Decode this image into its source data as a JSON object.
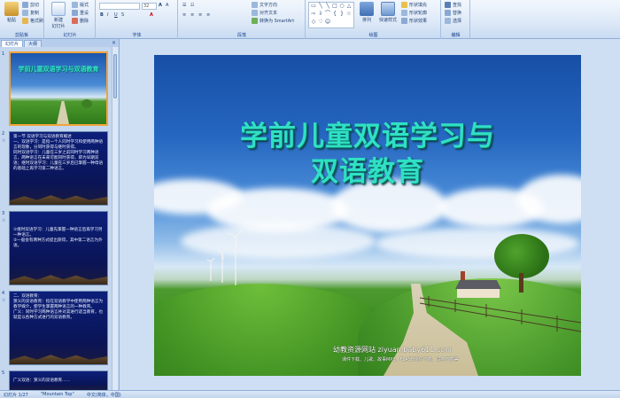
{
  "ribbon": {
    "clipboard": {
      "paste": "粘贴",
      "cut": "剪切",
      "copy": "复制",
      "format_painter": "格式刷",
      "label": "剪贴板"
    },
    "slides": {
      "new_slide": "新建\n幻灯片",
      "layout": "版式",
      "reset": "重设",
      "delete": "删除",
      "label": "幻灯片"
    },
    "font": {
      "size": "32",
      "label": "字体"
    },
    "paragraph": {
      "text_direction": "文字方向",
      "align_text": "对齐文本",
      "convert_smartart": "转换为 SmartArt",
      "label": "段落"
    },
    "drawing": {
      "arrange": "排列",
      "quick_styles": "快速样式",
      "shape_fill": "形状填充",
      "shape_outline": "形状轮廓",
      "shape_effects": "形状效果",
      "label": "绘图"
    },
    "editing": {
      "find": "查找",
      "replace": "替换",
      "select": "选择",
      "label": "编辑"
    }
  },
  "pane": {
    "tab_slides": "幻灯片",
    "tab_outline": "大纲",
    "close": "×",
    "thumbs": [
      {
        "num": "1",
        "title": "学前儿童双语学习与双语教育"
      },
      {
        "num": "2",
        "text": "第一节 双语学习与双语教育概述\n一、双语学习：是指一个人同时学习和使用两种语言的现象，分同时获得与继时获得。\n同时双语学习：儿童在三岁之前同时学习两种语言，两种语言在未来可能同时获得，即为早期双语；继时双语学习：儿童在三岁后已掌握一种母语的基础上再学习第二种语言。"
      },
      {
        "num": "3",
        "text": "①继时双语学习：儿童先掌握一种语言后再学习另一种语言。\n②一般会有两种方式提出获得，其中第二语言为外语。"
      },
      {
        "num": "4",
        "text": "二、双语教育：\n狭义的双语教育：指在双语教学中使用两种语言为教学媒介，使学生掌握两种语言的一种教育。\n广义：同时学习两种语言并对其进行适当教育，也就是以各种方式进行的双语教育。"
      },
      {
        "num": "5",
        "text": "广义双语：狭义的双语教育……"
      }
    ]
  },
  "slide": {
    "title_line1": "学前儿童双语学习与",
    "title_line2": "双语教育",
    "footer_line1": "幼教资源网站  ziyuan.baby611.com",
    "footer_line2": "课件下载、儿歌、故事MP3、FLASH课件下载、试卷下载等"
  },
  "status": {
    "slide_counter": "幻灯片 1/27",
    "theme": "\"Mountain Top\"",
    "language": "中文(简体，中国)"
  },
  "colors": {
    "title": "#2fe0c4",
    "ribbon_bg": "#dfeaf8",
    "selection": "#f2a43a"
  }
}
